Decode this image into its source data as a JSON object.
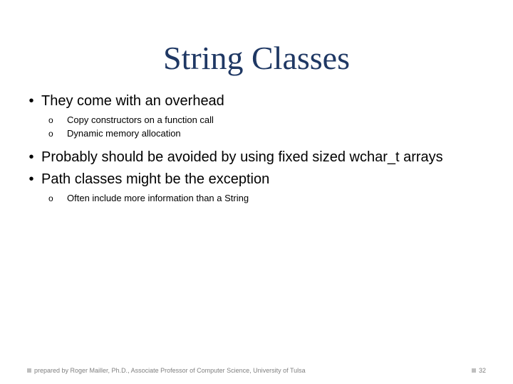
{
  "title": "String Classes",
  "bullets": {
    "b1": "They come with an overhead",
    "b1_1": "Copy constructors on a function call",
    "b1_2": "Dynamic memory allocation",
    "b2": "Probably should be avoided by using fixed sized wchar_t arrays",
    "b3": "Path classes might be the exception",
    "b3_1": "Often include more information than a String"
  },
  "footer": {
    "author": "prepared by Roger Mailler, Ph.D., Associate Professor of Computer Science, University of Tulsa",
    "page": "32"
  }
}
